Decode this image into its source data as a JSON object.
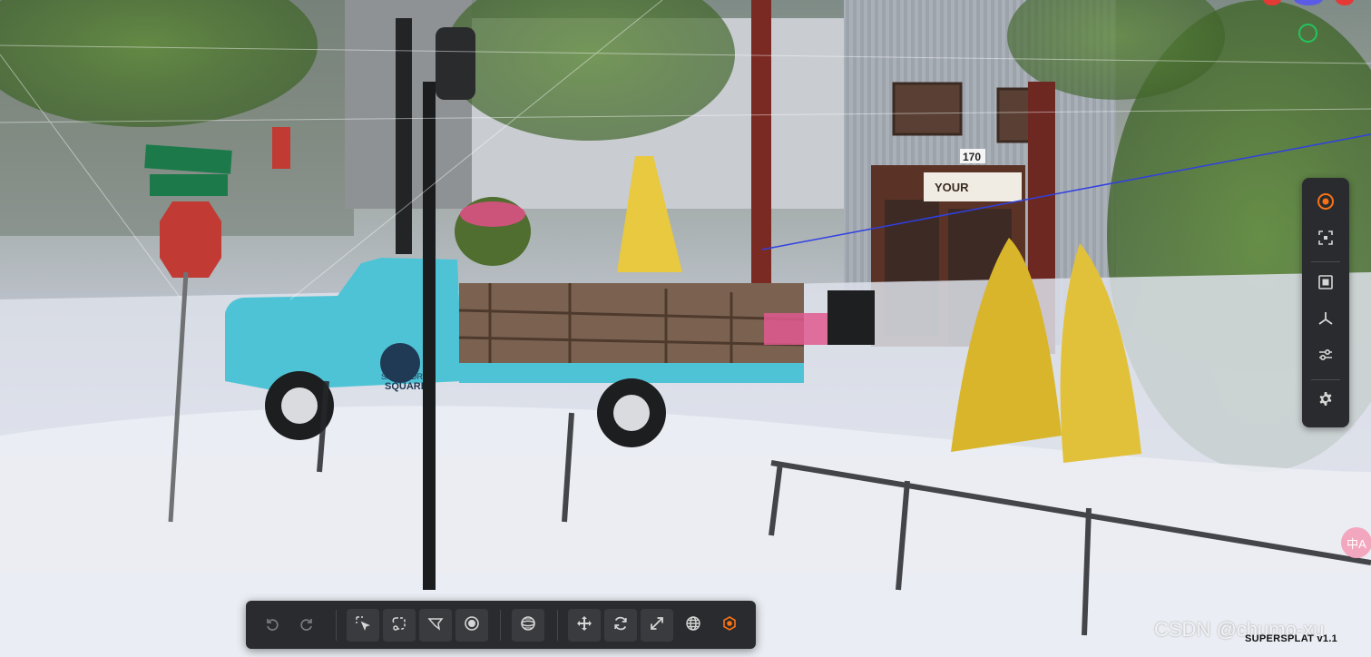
{
  "viewport": {
    "storefront_number": "170",
    "storefront_sign": "YOUR",
    "truck_door_text_line1": "SAN PEDRO",
    "truck_door_text_line2": "SQUARE"
  },
  "gizmo": {
    "dot_colors": [
      "#e53935",
      "#5b5ce6",
      "#e53935"
    ],
    "ring_color": "#22c55e"
  },
  "right_toolbar": {
    "accent": "#f97316",
    "icon_color": "#d6d6d6",
    "items": [
      {
        "icon": "target-icon",
        "active": true
      },
      {
        "icon": "frame-selection-icon"
      },
      {
        "icon": "bounding-box-icon"
      },
      {
        "icon": "axes-icon"
      },
      {
        "icon": "sliders-icon"
      },
      {
        "icon": "gear-icon"
      }
    ]
  },
  "bottom_toolbar": {
    "icon_color": "#d6d6d6",
    "disabled_color": "#7a7b7f",
    "accent": "#f97316",
    "groups": [
      [
        "undo-icon",
        "redo-icon"
      ],
      [
        "picker-select-icon",
        "lasso-select-icon",
        "polygon-select-icon",
        "brush-select-icon"
      ],
      [
        "sphere-select-icon"
      ],
      [
        "move-icon",
        "rotate-icon",
        "scale-icon",
        "world-space-icon",
        "pivot-icon"
      ]
    ]
  },
  "watermark": "CSDN @chumo-xu",
  "app_version": "SUPERSPLAT v1.1",
  "translate_bubble": "中A"
}
